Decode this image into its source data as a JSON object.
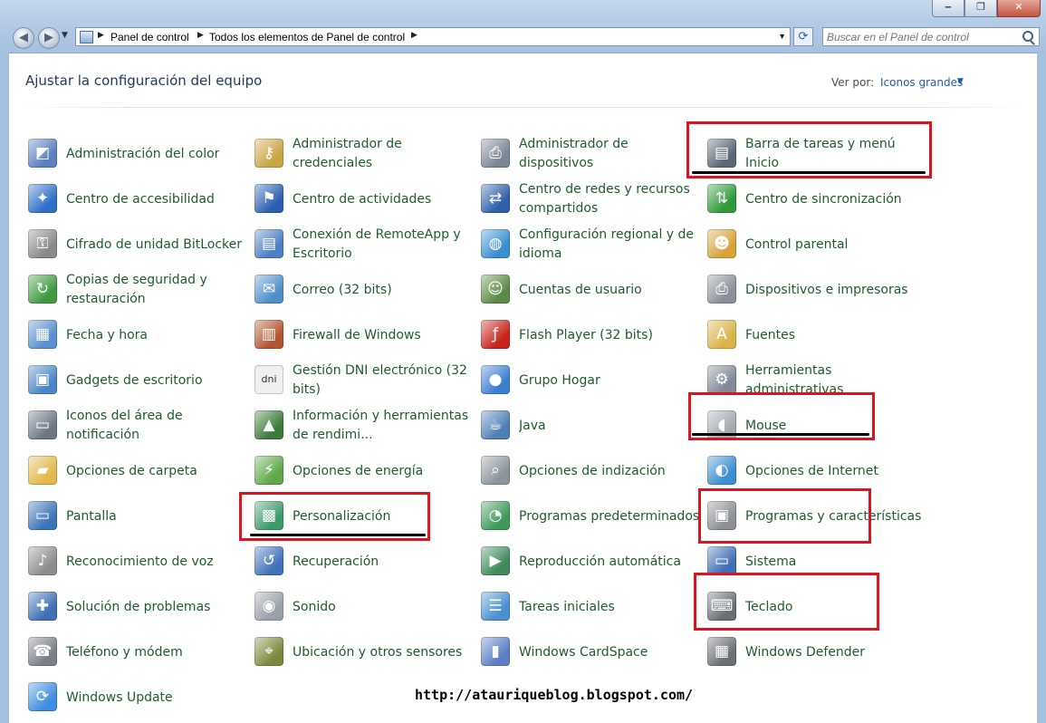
{
  "window": {
    "controls": [
      "‒",
      "❐",
      "✕"
    ]
  },
  "address": {
    "root": "Panel de control",
    "current": "Todos los elementos de Panel de control"
  },
  "search": {
    "placeholder": "Buscar en el Panel de control"
  },
  "header": {
    "title": "Ajustar la configuración del equipo",
    "view_label": "Ver por:",
    "view_value": "Iconos grandes"
  },
  "items": [
    {
      "label": "Administración del color",
      "icon": "color-management-icon",
      "color": "#5b7fbf"
    },
    {
      "label": "Centro de accesibilidad",
      "icon": "accessibility-icon",
      "color": "#2f6fc9"
    },
    {
      "label": "Cifrado de unidad BitLocker",
      "icon": "bitlocker-icon",
      "color": "#8a8a8a"
    },
    {
      "label": "Copias de seguridad y restauración",
      "icon": "backup-icon",
      "color": "#3f9a3f"
    },
    {
      "label": "Fecha y hora",
      "icon": "calendar-clock-icon",
      "color": "#5a8fd0"
    },
    {
      "label": "Gadgets de escritorio",
      "icon": "gadgets-icon",
      "color": "#4a86c5"
    },
    {
      "label": "Iconos del área de notificación",
      "icon": "notification-area-icon",
      "color": "#6d7784"
    },
    {
      "label": "Opciones de carpeta",
      "icon": "folder-options-icon",
      "color": "#e2b84a"
    },
    {
      "label": "Pantalla",
      "icon": "display-icon",
      "color": "#3b74b8"
    },
    {
      "label": "Reconocimiento de voz",
      "icon": "microphone-icon",
      "color": "#8d8d8d"
    },
    {
      "label": "Solución de problemas",
      "icon": "troubleshooting-icon",
      "color": "#3f6fb5"
    },
    {
      "label": "Teléfono y módem",
      "icon": "phone-modem-icon",
      "color": "#7a7f87"
    },
    {
      "label": "Windows Update",
      "icon": "windows-update-icon",
      "color": "#3e8ee0"
    },
    {
      "label": "Administrador de credenciales",
      "icon": "credential-manager-icon",
      "color": "#c9a643"
    },
    {
      "label": "Centro de actividades",
      "icon": "action-center-flag-icon",
      "color": "#2d5fb0"
    },
    {
      "label": "Conexión de RemoteApp y Escritorio",
      "icon": "remoteapp-icon",
      "color": "#4d7fc2"
    },
    {
      "label": "Correo (32 bits)",
      "icon": "mail-icon",
      "color": "#4f8fc9"
    },
    {
      "label": "Firewall de Windows",
      "icon": "firewall-icon",
      "color": "#b2552e"
    },
    {
      "label": "Gestión DNI electrónico (32 bits)",
      "icon": "dni-icon",
      "color": "#9aa3ad"
    },
    {
      "label": "Información y herramientas de rendimi...",
      "icon": "performance-icon",
      "color": "#3a7a3a"
    },
    {
      "label": "Opciones de energía",
      "icon": "power-options-icon",
      "color": "#5fa84a"
    },
    {
      "label": "Personalización",
      "icon": "personalization-icon",
      "color": "#3d9a6a"
    },
    {
      "label": "Recuperación",
      "icon": "recovery-icon",
      "color": "#3f72b8"
    },
    {
      "label": "Sonido",
      "icon": "speaker-icon",
      "color": "#9aa0a8"
    },
    {
      "label": "Ubicación y otros sensores",
      "icon": "location-sensors-icon",
      "color": "#7a8a3a"
    },
    {
      "label": "Administrador de dispositivos",
      "icon": "device-manager-icon",
      "color": "#7b8795"
    },
    {
      "label": "Centro de redes y recursos compartidos",
      "icon": "network-center-icon",
      "color": "#2f5fa8"
    },
    {
      "label": "Configuración regional y de idioma",
      "icon": "region-language-icon",
      "color": "#3a8fd0"
    },
    {
      "label": "Cuentas de usuario",
      "icon": "user-accounts-icon",
      "color": "#5c8a45"
    },
    {
      "label": "Flash Player (32 bits)",
      "icon": "flash-player-icon",
      "color": "#c8231d"
    },
    {
      "label": "Grupo Hogar",
      "icon": "homegroup-icon",
      "color": "#3a7fd0"
    },
    {
      "label": "Java",
      "icon": "java-icon",
      "color": "#4f7fb5"
    },
    {
      "label": "Opciones de indización",
      "icon": "indexing-icon",
      "color": "#8d949c"
    },
    {
      "label": "Programas predeterminados",
      "icon": "default-programs-icon",
      "color": "#3f9a5a"
    },
    {
      "label": "Reproducción automática",
      "icon": "autoplay-icon",
      "color": "#3f8a5a"
    },
    {
      "label": "Tareas iniciales",
      "icon": "getting-started-icon",
      "color": "#4a8fcf"
    },
    {
      "label": "Windows CardSpace",
      "icon": "cardspace-icon",
      "color": "#5b7fc4"
    },
    {
      "label": "Barra de tareas y menú Inicio",
      "icon": "taskbar-start-icon",
      "color": "#5b6775"
    },
    {
      "label": "Centro de sincronización",
      "icon": "sync-center-icon",
      "color": "#2f9a3a"
    },
    {
      "label": "Control parental",
      "icon": "parental-controls-icon",
      "color": "#d9a33a"
    },
    {
      "label": "Dispositivos e impresoras",
      "icon": "devices-printers-icon",
      "color": "#8a9099"
    },
    {
      "label": "Fuentes",
      "icon": "fonts-icon",
      "color": "#d9b44a"
    },
    {
      "label": "Herramientas administrativas",
      "icon": "admin-tools-icon",
      "color": "#7f8a96"
    },
    {
      "label": "Mouse",
      "icon": "mouse-icon",
      "color": "#a4a9b0"
    },
    {
      "label": "Opciones de Internet",
      "icon": "internet-options-icon",
      "color": "#3a8fd0"
    },
    {
      "label": "Programas y características",
      "icon": "programs-features-icon",
      "color": "#8c8f94"
    },
    {
      "label": "Sistema",
      "icon": "system-icon",
      "color": "#3f6fb5"
    },
    {
      "label": "Teclado",
      "icon": "keyboard-icon",
      "color": "#6a6f76"
    },
    {
      "label": "Windows Defender",
      "icon": "windows-defender-icon",
      "color": "#6b6f75"
    }
  ],
  "highlight_color": "#d9161f",
  "footer": {
    "blog_url": "http://atauriqueblog.blogspot.com/"
  }
}
